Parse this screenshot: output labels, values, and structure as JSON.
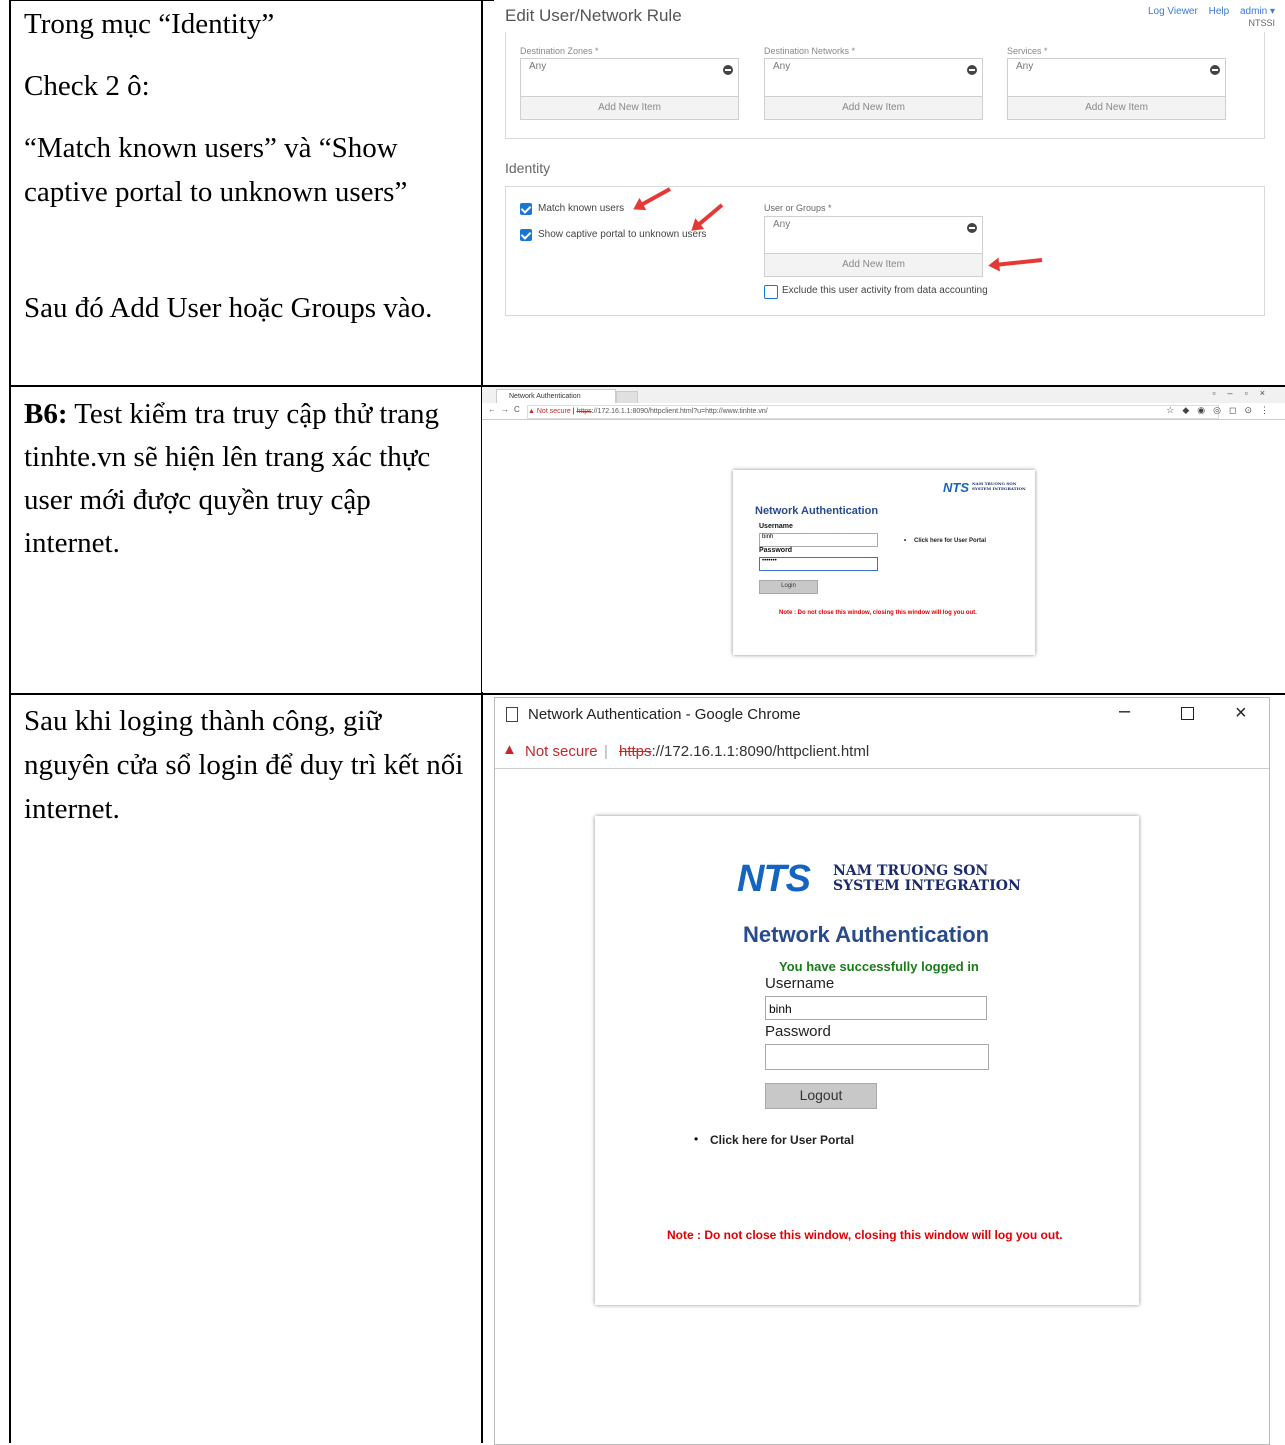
{
  "rows": [
    {
      "paragraphs": [
        "Trong mục “Identity”",
        "Check 2 ô:",
        "“Match known users” và “Show captive portal to unknown users”",
        "Sau đó Add User hoặc Groups vào."
      ]
    },
    {
      "step_label": "B6:",
      "text": " Test kiểm tra truy cập thử trang tinhte.vn sẽ hiện lên trang xác thực user mới được quyền truy cập internet."
    },
    {
      "text": "Sau khi loging thành công, giữ nguyên cửa sổ login để duy trì kết nối internet."
    }
  ],
  "panel1": {
    "title": "Edit User/Network Rule",
    "links": [
      "Log Viewer",
      "Help",
      "admin ▾"
    ],
    "org": "NTSSI",
    "fields": [
      {
        "label": "Destination Zones *",
        "value": "Any",
        "add": "Add New Item"
      },
      {
        "label": "Destination Networks *",
        "value": "Any",
        "add": "Add New Item"
      },
      {
        "label": "Services *",
        "value": "Any",
        "add": "Add New Item"
      }
    ],
    "identity": {
      "heading": "Identity",
      "check1": "Match known users",
      "check2": "Show captive portal to unknown users",
      "users_label": "User or Groups *",
      "users_value": "Any",
      "add": "Add New Item",
      "exclude": "Exclude this user activity from data accounting"
    },
    "colors": {
      "accent": "#1976d2",
      "arrow": "#e53935"
    }
  },
  "panel2": {
    "tab": "Network Authentication",
    "not_secure": "Not secure",
    "scheme": "https",
    "url_rest": "://172.16.1.1:8090/httpclient.html?u=http://www.tinhte.vn/",
    "logo": "NTS",
    "logo_sub": "NAM TRUONG SON SYSTEM INTEGRATION",
    "heading": "Network Authentication",
    "username_label": "Username",
    "username_value": "binh",
    "password_label": "Password",
    "password_value": "•••••••",
    "login": "Login",
    "portal_link": "Click here for User Portal",
    "note": "Note : Do not close this window, closing this window will log you out."
  },
  "panel3": {
    "window_title": "Network Authentication - Google Chrome",
    "not_secure": "Not secure",
    "scheme": "https",
    "url_rest": "://172.16.1.1:8090/httpclient.html",
    "logo": "NTS",
    "logo_line1": "NAM TRUONG SON",
    "logo_line2": "SYSTEM INTEGRATION",
    "heading": "Network Authentication",
    "success": "You have successfully logged in",
    "username_label": "Username",
    "username_value": "binh",
    "password_label": "Password",
    "logout": "Logout",
    "portal_link": "Click here for User Portal",
    "note": "Note : Do not close this window, closing this window will log you out."
  }
}
